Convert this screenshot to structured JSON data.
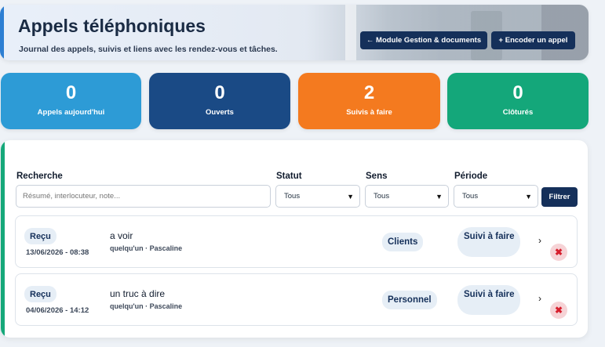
{
  "header": {
    "title": "Appels téléphoniques",
    "subtitle": "Journal des appels, suivis et liens avec les rendez-vous et tâches.",
    "btn_module": "← Module Gestion & documents",
    "btn_encode": "+ Encoder un appel"
  },
  "stats": [
    {
      "value": "0",
      "label": "Appels aujourd'hui",
      "color": "#2d9bd6"
    },
    {
      "value": "0",
      "label": "Ouverts",
      "color": "#1a4a85"
    },
    {
      "value": "2",
      "label": "Suivis à faire",
      "color": "#f47a1f"
    },
    {
      "value": "0",
      "label": "Clôturés",
      "color": "#14a77a"
    }
  ],
  "filters": {
    "search_label": "Recherche",
    "search_placeholder": "Résumé, interlocuteur, note...",
    "statut_label": "Statut",
    "statut_value": "Tous",
    "sens_label": "Sens",
    "sens_value": "Tous",
    "periode_label": "Période",
    "periode_value": "Tous",
    "filter_button": "Filtrer"
  },
  "calls": [
    {
      "status": "Reçu",
      "date": "13/06/2026 - 08:38",
      "subject": "a voir",
      "who": "quelqu'un · Pascaline",
      "sens": "Clients",
      "suivi": "Suivi à faire"
    },
    {
      "status": "Reçu",
      "date": "04/06/2026 - 14:12",
      "subject": "un truc à dire",
      "who": "quelqu'un · Pascaline",
      "sens": "Personnel",
      "suivi": "Suivi à faire"
    }
  ],
  "icons": {
    "chevron": "chevron-right-icon",
    "delete": "delete-x-icon",
    "select": "chevron-down-icon"
  }
}
